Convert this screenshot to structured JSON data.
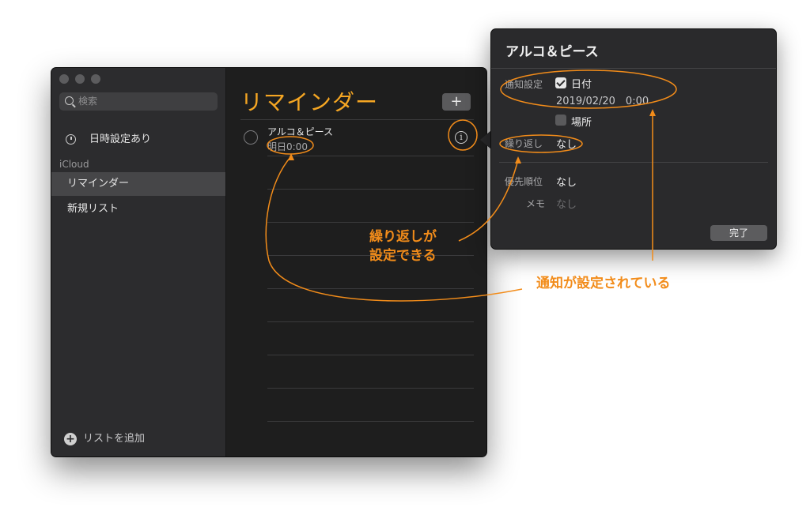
{
  "sidebar": {
    "search_placeholder": "検索",
    "scheduled": "日時設定あり",
    "section": "iCloud",
    "items": [
      {
        "label": "リマインダー",
        "selected": true
      },
      {
        "label": "新規リスト",
        "selected": false
      }
    ],
    "add_list": "リストを追加"
  },
  "main": {
    "title": "リマインダー",
    "add_symbol": "+",
    "task": {
      "title": "アルコ＆ピース",
      "date": "明日0:00"
    }
  },
  "popover": {
    "title": "アルコ＆ピース",
    "notify_label": "通知設定",
    "date_label": "日付",
    "date_value": "2019/02/20　0:00",
    "location_label": "場所",
    "repeat_label": "繰り返し",
    "repeat_value": "なし",
    "priority_label": "優先順位",
    "priority_value": "なし",
    "memo_label": "メモ",
    "memo_value": "なし",
    "done": "完了"
  },
  "annotations": {
    "repeat_line1": "繰り返しが",
    "repeat_line2": "設定できる",
    "notify": "通知が設定されている"
  },
  "colors": {
    "accent": "#f5a623",
    "annotation": "#f28c1a"
  }
}
